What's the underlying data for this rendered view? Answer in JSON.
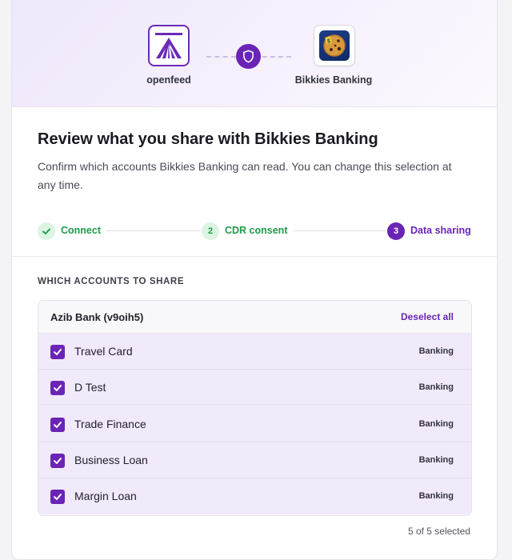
{
  "header": {
    "source_app": {
      "name": "openfeed",
      "icon": "openfeed-logo"
    },
    "connector_icon": "shield-icon",
    "target_app": {
      "name": "Bikkies Banking",
      "icon": "cookie-logo"
    }
  },
  "review": {
    "title": "Review what you share with Bikkies Banking",
    "description": "Confirm which accounts Bikkies Banking can read. You can change this selection at any time."
  },
  "stepper": {
    "steps": [
      {
        "number": "✓",
        "label": "Connect",
        "state": "done"
      },
      {
        "number": "2",
        "label": "CDR consent",
        "state": "done"
      },
      {
        "number": "3",
        "label": "Data sharing",
        "state": "active"
      }
    ]
  },
  "accounts": {
    "heading": "WHICH ACCOUNTS TO SHARE",
    "bank_name": "Azib Bank (v9oih5)",
    "deselect_label": "Deselect all",
    "items": [
      {
        "name": "Travel Card",
        "type": "Banking",
        "checked": true
      },
      {
        "name": "D Test",
        "type": "Banking",
        "checked": true
      },
      {
        "name": "Trade Finance",
        "type": "Banking",
        "checked": true
      },
      {
        "name": "Business Loan",
        "type": "Banking",
        "checked": true
      },
      {
        "name": "Margin Loan",
        "type": "Banking",
        "checked": true
      }
    ],
    "selected_summary": "5 of 5 selected"
  },
  "colors": {
    "accent": "#6a24b6",
    "success": "#1f9a4a",
    "row_selected_bg": "#f1eafb"
  }
}
